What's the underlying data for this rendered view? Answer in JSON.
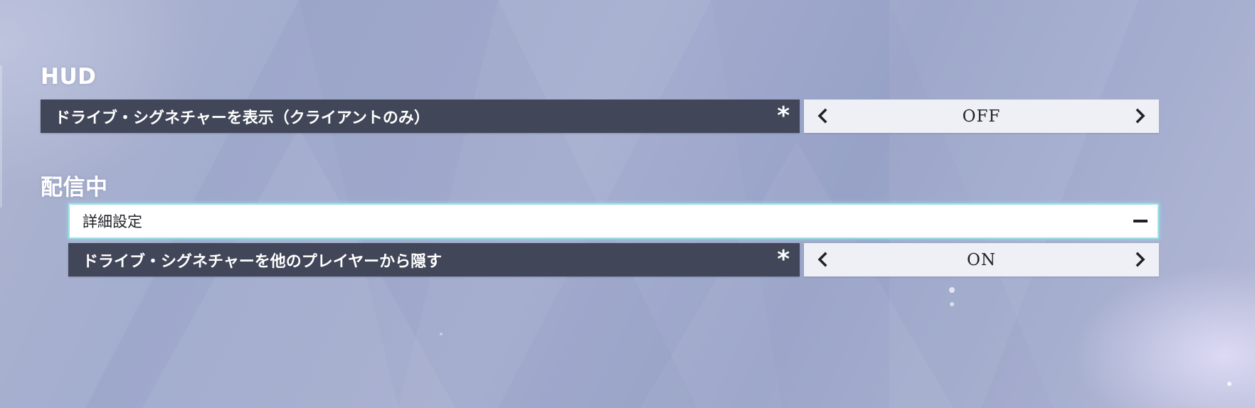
{
  "sections": [
    {
      "title": "HUD",
      "settings": [
        {
          "label": "ドライブ・シグネチャーを表示（クライアントのみ）",
          "marker": "*",
          "value": "OFF"
        }
      ]
    },
    {
      "title": "配信中",
      "advanced": {
        "label": "詳細設定",
        "expanded": true
      },
      "settings": [
        {
          "label": "ドライブ・シグネチャーを他のプレイヤーから隠す",
          "marker": "*",
          "value": "ON"
        }
      ]
    }
  ],
  "icons": {
    "prev": "chevron-left-icon",
    "next": "chevron-right-icon",
    "collapse": "minus-icon"
  },
  "colors": {
    "label_bg": "#414658",
    "selector_bg": "#eef0f5",
    "focus_outline": "#9fe3ec"
  }
}
